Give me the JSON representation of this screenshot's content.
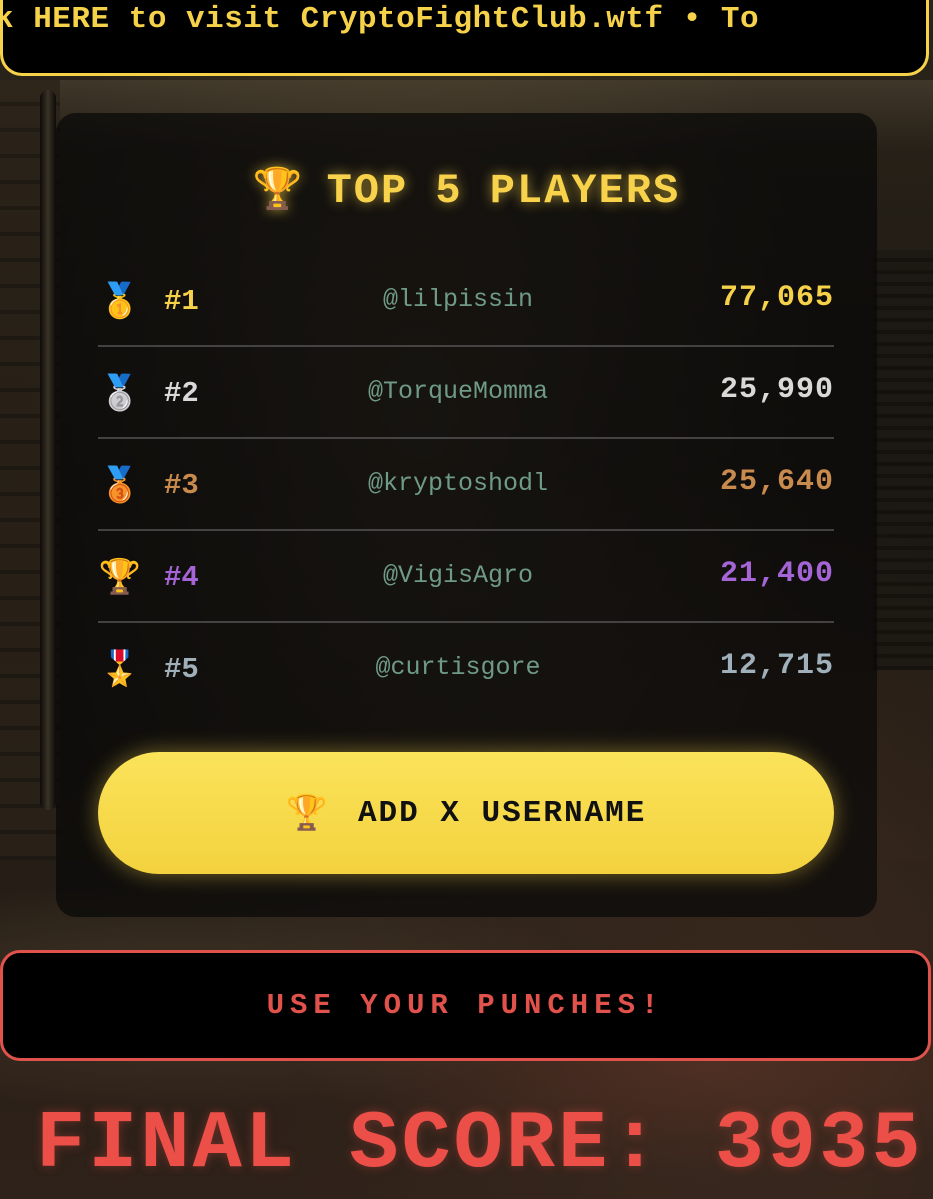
{
  "ticker": {
    "text": "k HERE to visit CryptoFightClub.wtf  •  To"
  },
  "leaderboard": {
    "title": "TOP 5 PLAYERS",
    "title_icon": "trophy-icon",
    "rows": [
      {
        "medal_icon": "gold-medal-icon",
        "medal_glyph": "🥇",
        "rank": "#1",
        "username": "@lilpissin",
        "score": "77,065",
        "color": "#f5d24a"
      },
      {
        "medal_icon": "silver-medal-icon",
        "medal_glyph": "🥈",
        "rank": "#2",
        "username": "@TorqueMomma",
        "score": "25,990",
        "color": "#d9d9d9"
      },
      {
        "medal_icon": "bronze-medal-icon",
        "medal_glyph": "🥉",
        "rank": "#3",
        "username": "@kryptoshodl",
        "score": "25,640",
        "color": "#c98a4e"
      },
      {
        "medal_icon": "trophy-icon",
        "medal_glyph": "🏆",
        "rank": "#4",
        "username": "@VigisAgro",
        "score": "21,400",
        "color": "#a565d6"
      },
      {
        "medal_icon": "military-medal-icon",
        "medal_glyph": "🎖️",
        "rank": "#5",
        "username": "@curtisgore",
        "score": "12,715",
        "color": "#9fb0bb"
      }
    ],
    "add_button_label": "ADD X USERNAME",
    "add_button_icon": "trophy-icon"
  },
  "punch_prompt": "USE YOUR PUNCHES!",
  "final_score": "FINAL SCORE: 3935",
  "colors": {
    "accent_yellow": "#f5d24a",
    "accent_red": "#e0524b"
  }
}
